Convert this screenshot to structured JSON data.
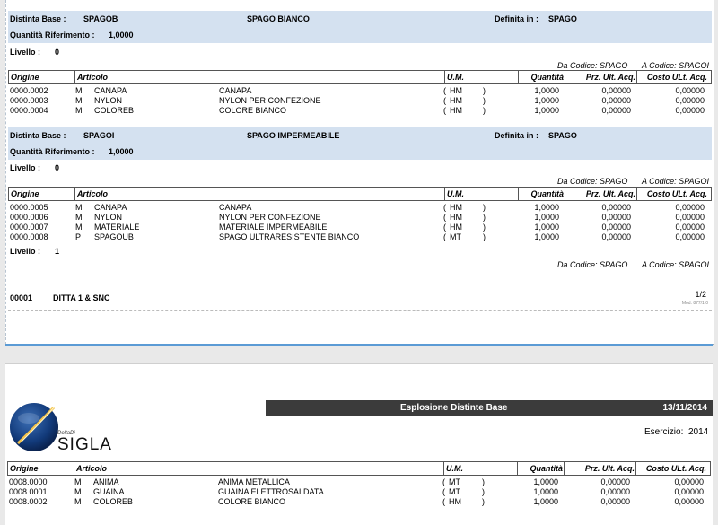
{
  "columns": {
    "origine": "Origine",
    "articolo": "Articolo",
    "um": "U.M.",
    "quantita": "Quantità",
    "prz": "Prz. Ult. Acq.",
    "costo": "Costo ULt. Acq."
  },
  "sections": [
    {
      "distinta_label": "Distinta Base :",
      "distinta_code": "SPAGOB",
      "distinta_desc": "SPAGO BIANCO",
      "definita_label": "Definita in :",
      "definita_value": "SPAGO",
      "qta_label": "Quantità Riferimento :",
      "qta_value": "1,0000",
      "livello_label": "Livello :",
      "livello_value": "0",
      "da_codice": "Da Codice: SPAGO",
      "a_codice": "A Codice: SPAGOI",
      "rows": [
        {
          "origine": "0000.0002",
          "tipo": "M",
          "articolo": "CANAPA",
          "descrizione": "CANAPA",
          "um_open": "(",
          "um": "HM",
          "um_close": ")",
          "quantita": "1,0000",
          "prz": "0,00000",
          "costo": "0,00000"
        },
        {
          "origine": "0000.0003",
          "tipo": "M",
          "articolo": "NYLON",
          "descrizione": "NYLON PER CONFEZIONE",
          "um_open": "(",
          "um": "HM",
          "um_close": ")",
          "quantita": "1,0000",
          "prz": "0,00000",
          "costo": "0,00000"
        },
        {
          "origine": "0000.0004",
          "tipo": "M",
          "articolo": "COLOREB",
          "descrizione": "COLORE BIANCO",
          "um_open": "(",
          "um": "HM",
          "um_close": ")",
          "quantita": "1,0000",
          "prz": "0,00000",
          "costo": "0,00000"
        }
      ]
    },
    {
      "distinta_label": "Distinta Base :",
      "distinta_code": "SPAGOI",
      "distinta_desc": "SPAGO IMPERMEABILE",
      "definita_label": "Definita in :",
      "definita_value": "SPAGO",
      "qta_label": "Quantità Riferimento :",
      "qta_value": "1,0000",
      "livello_label": "Livello :",
      "livello_value": "0",
      "da_codice": "Da Codice: SPAGO",
      "a_codice": "A Codice: SPAGOI",
      "rows": [
        {
          "origine": "0000.0005",
          "tipo": "M",
          "articolo": "CANAPA",
          "descrizione": "CANAPA",
          "um_open": "(",
          "um": "HM",
          "um_close": ")",
          "quantita": "1,0000",
          "prz": "0,00000",
          "costo": "0,00000"
        },
        {
          "origine": "0000.0006",
          "tipo": "M",
          "articolo": "NYLON",
          "descrizione": "NYLON PER CONFEZIONE",
          "um_open": "(",
          "um": "HM",
          "um_close": ")",
          "quantita": "1,0000",
          "prz": "0,00000",
          "costo": "0,00000"
        },
        {
          "origine": "0000.0007",
          "tipo": "M",
          "articolo": "MATERIALE",
          "descrizione": "MATERIALE IMPERMEABILE",
          "um_open": "(",
          "um": "HM",
          "um_close": ")",
          "quantita": "1,0000",
          "prz": "0,00000",
          "costo": "0,00000"
        },
        {
          "origine": "0000.0008",
          "tipo": "P",
          "articolo": "SPAGOUB",
          "descrizione": "SPAGO ULTRARESISTENTE BIANCO",
          "um_open": "(",
          "um": "MT",
          "um_close": ")",
          "quantita": "1,0000",
          "prz": "0,00000",
          "costo": "0,00000"
        }
      ],
      "livello2_label": "Livello :",
      "livello2_value": "1",
      "da_codice2": "Da Codice: SPAGO",
      "a_codice2": "A Codice: SPAGOI"
    }
  ],
  "footer": {
    "company_code": "00001",
    "company_name": "DITTA 1 & SNC",
    "page": "1/2",
    "mod": "Mod. 877/1.0"
  },
  "page2": {
    "report_title": "Esplosione Distinte Base",
    "date": "13/11/2014",
    "esercizio_label": "Esercizio:",
    "esercizio_value": "2014",
    "logo_small": "DeltaDi",
    "logo_text": "SIGLA",
    "rows": [
      {
        "origine": "0008.0000",
        "tipo": "M",
        "articolo": "ANIMA",
        "descrizione": "ANIMA METALLICA",
        "um_open": "(",
        "um": "MT",
        "um_close": ")",
        "quantita": "1,0000",
        "prz": "0,00000",
        "costo": "0,00000"
      },
      {
        "origine": "0008.0001",
        "tipo": "M",
        "articolo": "GUAINA",
        "descrizione": "GUAINA ELETTROSALDATA",
        "um_open": "(",
        "um": "MT",
        "um_close": ")",
        "quantita": "1,0000",
        "prz": "0,00000",
        "costo": "0,00000"
      },
      {
        "origine": "0008.0002",
        "tipo": "M",
        "articolo": "COLOREB",
        "descrizione": "COLORE BIANCO",
        "um_open": "(",
        "um": "HM",
        "um_close": ")",
        "quantita": "1,0000",
        "prz": "0,00000",
        "costo": "0,00000"
      }
    ]
  },
  "colors": {
    "band": "#d4e1f0",
    "separator": "#5b9bd5",
    "title_bar": "#3b3b3b"
  }
}
